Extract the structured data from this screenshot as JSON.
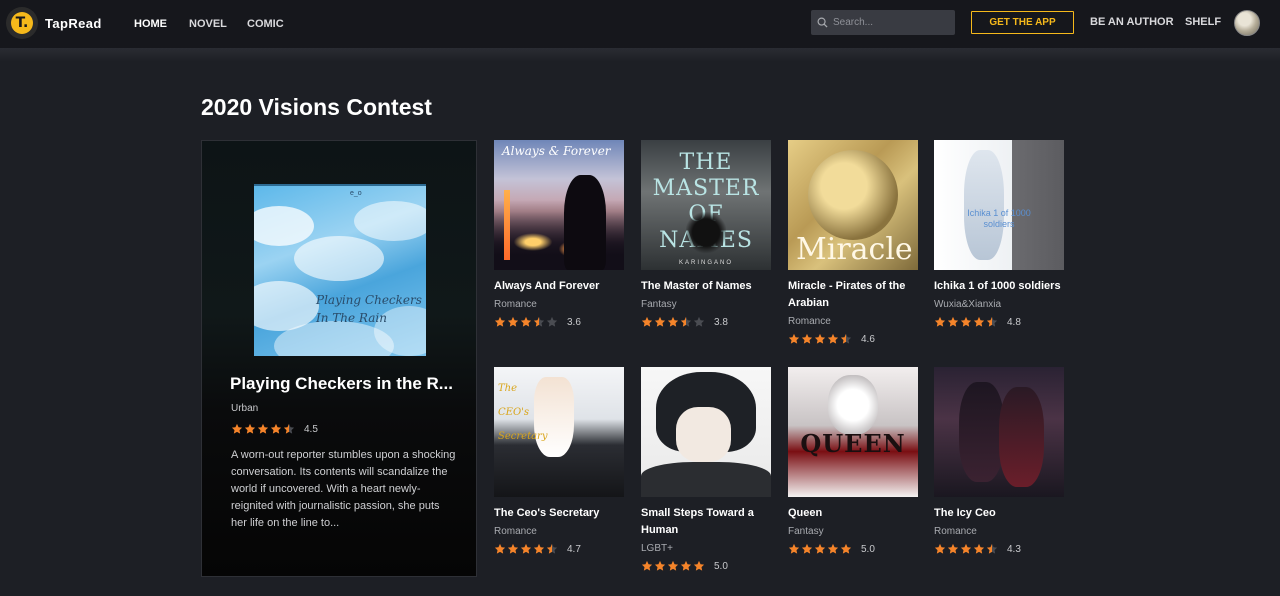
{
  "header": {
    "logo_text": "TapRead",
    "logo_glyph": "T.",
    "nav": [
      "HOME",
      "NOVEL",
      "COMIC"
    ],
    "active_nav": "HOME",
    "search_placeholder": "Search...",
    "get_app": "GET THE APP",
    "be_author": "BE AN AUTHOR",
    "shelf": "SHELF"
  },
  "page": {
    "title": "2020 Visions Contest"
  },
  "featured": {
    "title": "Playing Checkers in the R...",
    "cover_title_line1": "Playing Checkers",
    "cover_title_line2": "In The Rain",
    "cover_tiny": "e_o",
    "genre": "Urban",
    "rating": 4.5,
    "rating_label": "4.5",
    "description": "A worn-out reporter stumbles upon a shocking conversation. Its contents will scandalize the world if uncovered. With a heart newly-reignited with journalistic passion, she puts her life on the line to..."
  },
  "books": [
    {
      "title": "Always And Forever",
      "genre": "Romance",
      "rating": 3.5,
      "rating_label": "3.6",
      "cover": "always",
      "cover_text": "Always & Forever"
    },
    {
      "title": "The Master of Names",
      "genre": "Fantasy",
      "rating": 3.5,
      "rating_label": "3.8",
      "cover": "master",
      "cover_text": "THE MASTER OF NAMES",
      "cover_sub": "KARINGANO"
    },
    {
      "title": "Miracle - Pirates of the Arabian",
      "genre": "Romance",
      "rating": 4.5,
      "rating_label": "4.6",
      "cover": "miracle",
      "cover_text": "Miracle"
    },
    {
      "title": "Ichika 1 of 1000 soldiers",
      "genre": "Wuxia&Xianxia",
      "rating": 4.5,
      "rating_label": "4.8",
      "cover": "ichika",
      "cover_text": "Ichika 1 of 1000 soldiers"
    },
    {
      "title": "The Ceo's Secretary",
      "genre": "Romance",
      "rating": 4.5,
      "rating_label": "4.7",
      "cover": "ceo",
      "cover_text": "The CEO's Secretary"
    },
    {
      "title": "Small Steps Toward a Human",
      "genre": "LGBT+",
      "rating": 5,
      "rating_label": "5.0",
      "cover": "steps",
      "cover_text": ""
    },
    {
      "title": "Queen",
      "genre": "Fantasy",
      "rating": 5,
      "rating_label": "5.0",
      "cover": "queen",
      "cover_text": "QUEEN"
    },
    {
      "title": "The Icy Ceo",
      "genre": "Romance",
      "rating": 4.5,
      "rating_label": "4.3",
      "cover": "icy",
      "cover_text": ""
    }
  ],
  "colors": {
    "accent": "#f6b91b",
    "star": "#f5842a",
    "star_empty": "#4a4c52",
    "background": "#1d1f25",
    "header": "#16171c"
  }
}
